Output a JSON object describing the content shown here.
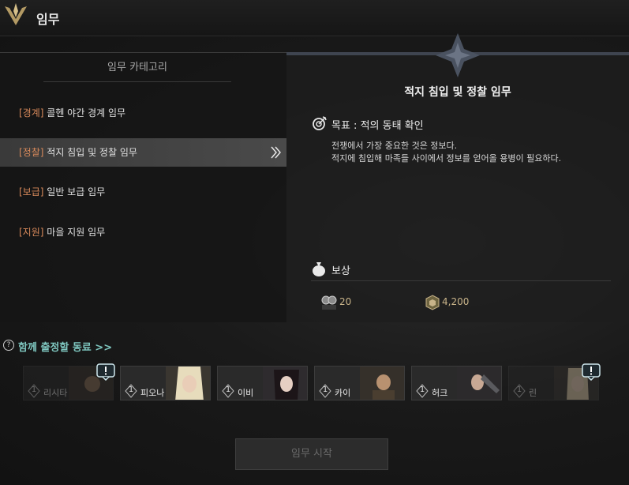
{
  "window": {
    "title": "임무"
  },
  "categories": {
    "header": "임무 카테고리",
    "items": [
      {
        "tag": "[경계]",
        "label": "콜헨 야간 경계 임무",
        "selected": false
      },
      {
        "tag": "[정찰]",
        "label": "적지 침입 및 정찰 임무",
        "selected": true
      },
      {
        "tag": "[보급]",
        "label": "일반 보급 임무",
        "selected": false
      },
      {
        "tag": "[지원]",
        "label": "마을 지원 임무",
        "selected": false
      }
    ]
  },
  "detail": {
    "title": "적지 침입 및 정찰 임무",
    "goal": "목표 : 적의 동태 확인",
    "desc_line1": "전쟁에서 가장 중요한 것은 정보다.",
    "desc_line2": "적지에 침입해 마족들 사이에서 정보를 얻어올 용병이 필요하다.",
    "reward_label": "보상",
    "reward_ap": "20",
    "reward_silver": "4,200"
  },
  "companions": {
    "header": "함께 출정할 동료 >>",
    "help": "?",
    "list": [
      {
        "level": "1",
        "name": "리시타",
        "available": false,
        "alert": true
      },
      {
        "level": "1",
        "name": "피오나",
        "available": true,
        "alert": false
      },
      {
        "level": "1",
        "name": "이비",
        "available": true,
        "alert": false
      },
      {
        "level": "1",
        "name": "카이",
        "available": true,
        "alert": false
      },
      {
        "level": "1",
        "name": "허크",
        "available": true,
        "alert": false
      },
      {
        "level": "1",
        "name": "린",
        "available": false,
        "alert": true
      }
    ]
  },
  "start_button": {
    "label": "임무 시작"
  },
  "colors": {
    "accent_tag": "#d98a5b",
    "companion_header": "#7fc7c0",
    "reward_value": "#c9b48a"
  }
}
